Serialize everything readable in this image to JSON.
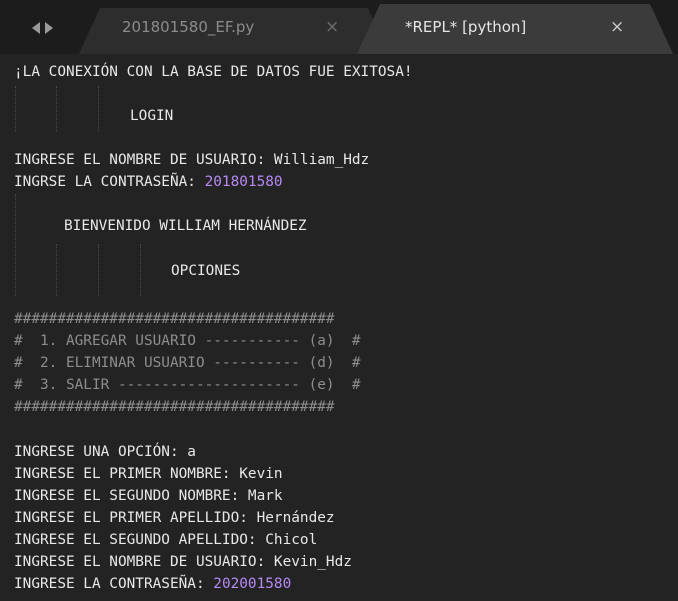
{
  "tabs": [
    {
      "label": "201801580_EF.py",
      "close": "×",
      "active": false
    },
    {
      "label": "*REPL* [python]",
      "close": "×",
      "active": true
    }
  ],
  "console": {
    "connection_msg": "¡LA CONEXIÓN CON LA BASE DE DATOS FUE EXITOSA!",
    "login_title": "LOGIN",
    "username_prompt": "INGRESE EL NOMBRE DE USUARIO: ",
    "username_value": "William_Hdz",
    "password_prompt": "INGRSE LA CONTRASEÑA: ",
    "password_value": "201801580",
    "welcome": "BIENVENIDO WILLIAM HERNÁNDEZ",
    "options_title": "OPCIONES",
    "menu": [
      "#####################################",
      "#  1. AGREGAR USUARIO ----------- (a)  #",
      "#  2. ELIMINAR USUARIO ---------- (d)  #",
      "#  3. SALIR --------------------- (e)  #",
      "#####################################"
    ],
    "option_prompt": "INGRESE UNA OPCIÓN: ",
    "option_value": "a",
    "first_name": "INGRESE EL PRIMER NOMBRE: Kevin",
    "second_name": "INGRESE EL SEGUNDO NOMBRE: Mark",
    "first_last": "INGRESE EL PRIMER APELLIDO: Hernández",
    "second_last": "INGRESE EL SEGUNDO APELLIDO: Chicol",
    "new_username": "INGRESE EL NOMBRE DE USUARIO: Kevin_Hdz",
    "new_password_prompt": "INGRESE LA CONTRASEÑA: ",
    "new_password_value": "202001580"
  },
  "colors": {
    "background": "#232323",
    "text": "#e8e8e8",
    "number": "#b78af6",
    "menu_text": "#8d8d8d"
  }
}
